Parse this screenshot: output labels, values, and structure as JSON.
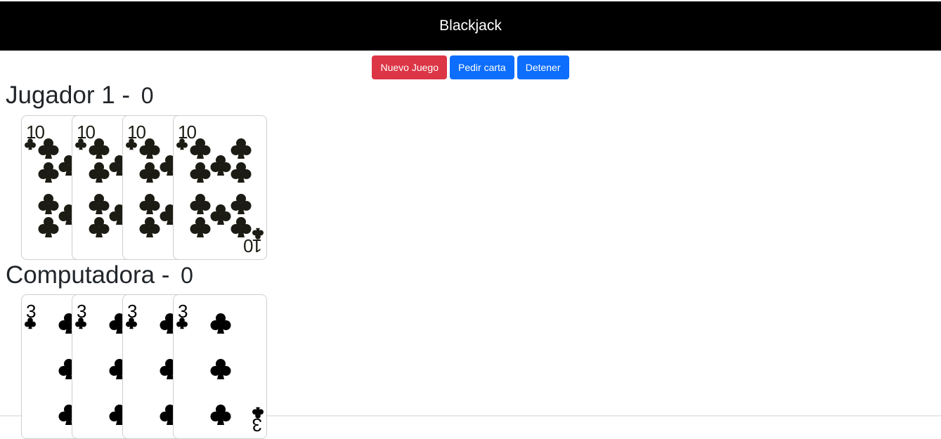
{
  "header": {
    "title": "Blackjack"
  },
  "toolbar": {
    "new_game_label": "Nuevo Juego",
    "hit_label": "Pedir carta",
    "stand_label": "Detener"
  },
  "player": {
    "name": "Jugador 1 - ",
    "score": "0",
    "cards": [
      "10C",
      "10C",
      "10C",
      "10C"
    ],
    "rank": "10"
  },
  "computer": {
    "name": "Computadora - ",
    "score": "0",
    "cards": [
      "3C",
      "3C",
      "3C",
      "3C"
    ],
    "rank": "3"
  },
  "colors": {
    "danger": "#dc3545",
    "primary": "#0d6efd",
    "header_bg": "#000000"
  },
  "icons": {
    "suit": "club-icon"
  }
}
